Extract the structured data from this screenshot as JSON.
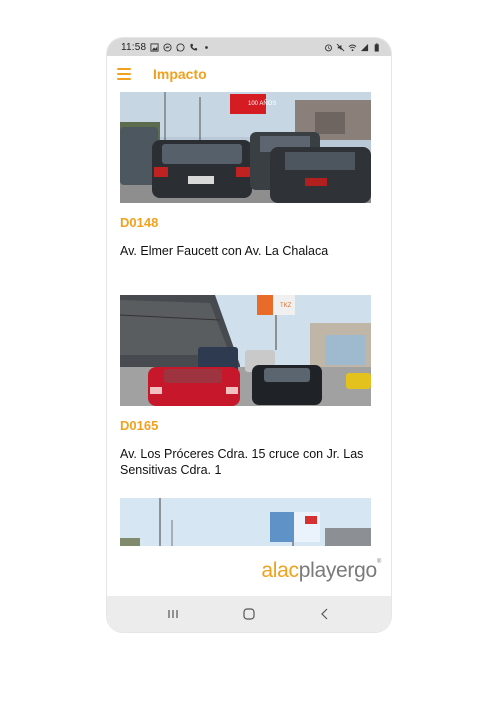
{
  "status_bar": {
    "time": "11:58",
    "left_icons": [
      "gallery-icon",
      "messenger-icon",
      "whatsapp-icon",
      "phone-icon",
      "dot-icon"
    ],
    "right_icons": [
      "alarm-icon",
      "mute-icon",
      "wifi-icon",
      "signal-icon",
      "battery-icon"
    ]
  },
  "app_bar": {
    "title": "Impacto",
    "menu_icon": "hamburger-menu-icon"
  },
  "listings": [
    {
      "code": "D0148",
      "address": "Av. Elmer Faucett con Av. La Chalaca",
      "billboard_text": "100 AÑOS"
    },
    {
      "code": "D0165",
      "address": "Av. Los Próceres Cdra. 15 cruce con Jr. Las Sensitivas Cdra. 1",
      "billboard_text": "TKZ"
    },
    {
      "code": "",
      "address": "",
      "billboard_text": ""
    }
  ],
  "brand": {
    "part1": "alac",
    "part2": "playergo",
    "mark": "®"
  },
  "nav_bar": {
    "items": [
      "recents-icon",
      "home-icon",
      "back-icon"
    ]
  },
  "colors": {
    "accent": "#f2a11f",
    "status_bar": "#d9d9d9",
    "nav_bar": "#ececec",
    "text": "#111111"
  }
}
